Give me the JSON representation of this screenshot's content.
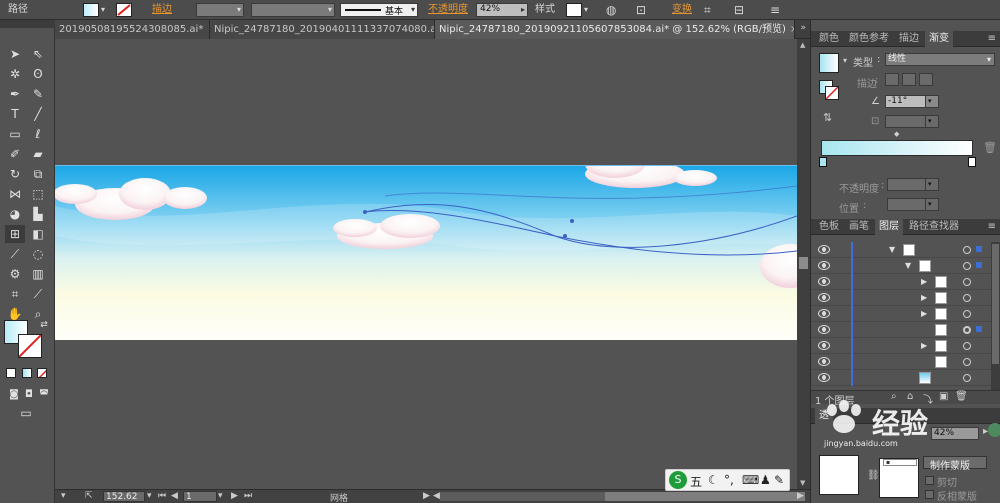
{
  "control_bar": {
    "object_type": "路径",
    "stroke_label": "描边",
    "stroke_profile": "基本",
    "opacity_label": "不透明度",
    "opacity_value": "42%",
    "style_label": "样式",
    "transform_label": "变换"
  },
  "doc_tabs": [
    {
      "label": "20190508195524308085.ai*"
    },
    {
      "label": "Nipic_24787180_20190401111337074080.ai*"
    },
    {
      "label": "Nipic_24787180_20190921105607853084.ai* @ 152.62% (RGB/预览)",
      "active": true
    }
  ],
  "status_bar": {
    "zoom": "152.62",
    "artboard": "1",
    "mode": "网格"
  },
  "gradient_panel": {
    "tabs": [
      "颜色",
      "颜色参考",
      "描边",
      "渐变"
    ],
    "active_tab": "渐变",
    "type_label": "类型",
    "type_value": "线性",
    "stroke_label": "描边",
    "angle_value": "-11°",
    "opacity_label": "不透明度",
    "location_label": "位置",
    "ramp_start_color": "#a8e6f0",
    "ramp_end_color": "#ffffff"
  },
  "layers_panel": {
    "tabs": [
      "色板",
      "画笔",
      "图层",
      "路径查找器"
    ],
    "active_tab": "图层",
    "footer_text": "1 个图层",
    "rows": [
      {
        "indent": 0,
        "arrow": "▼"
      },
      {
        "indent": 1,
        "arrow": "▼"
      },
      {
        "indent": 2,
        "arrow": "▶"
      },
      {
        "indent": 2,
        "arrow": "▶"
      },
      {
        "indent": 2,
        "arrow": "▶"
      },
      {
        "indent": 2,
        "arrow": ""
      },
      {
        "indent": 2,
        "arrow": "▶"
      },
      {
        "indent": 2,
        "arrow": ""
      },
      {
        "indent": 1,
        "arrow": ""
      }
    ]
  },
  "transparency_panel": {
    "opacity_value": "42%",
    "make_mask_label": "制作蒙版",
    "clip_label": "剪切",
    "invert_mask_label": "反相蒙版"
  },
  "ime_bar": {
    "label": "五"
  },
  "watermark": {
    "text": "经验",
    "subtext": "jingyan.baidu.com"
  },
  "colors": {
    "panel_bg": "#535353",
    "accent_orange": "#e8962f",
    "selection_blue": "#3d6fd6",
    "sky_top": "#1ea9e8",
    "sky_mid": "#bfe9f4",
    "sky_low": "#fbfbe3"
  }
}
